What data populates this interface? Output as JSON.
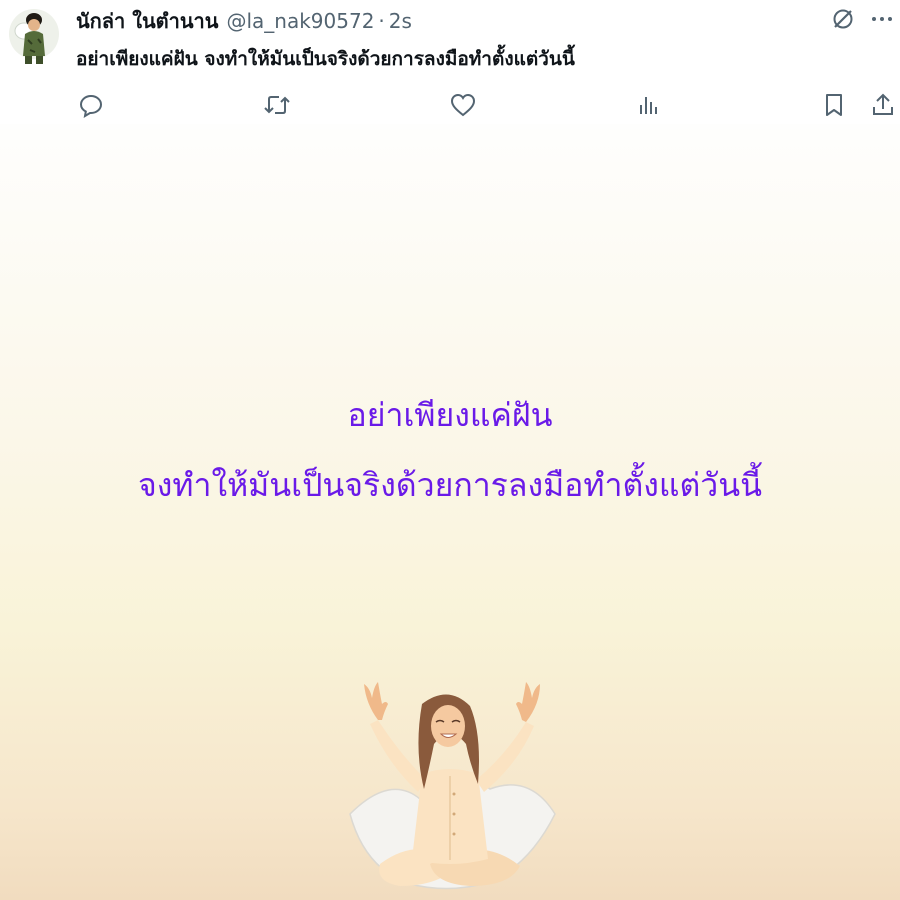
{
  "author": {
    "display_name": "นักล่า ในตำนาน",
    "handle": "@la_nak90572",
    "separator": "·",
    "time": "2s"
  },
  "tweet": {
    "text": "อย่าเพียงแค่ฝัน จงทำให้มันเป็นจริงด้วยการลงมือทำตั้งแต่วันนี้"
  },
  "media": {
    "line1": "อย่าเพียงแค่ฝัน",
    "line2": "จงทำให้มันเป็นจริงด้วยการลงมือทำตั้งแต่วันนี้",
    "text_color": "#6a1ae8"
  },
  "icons": {
    "top": [
      "grok-icon",
      "more-icon"
    ],
    "actions": [
      "reply-icon",
      "retweet-icon",
      "like-icon",
      "views-icon",
      "bookmark-icon",
      "share-icon"
    ]
  }
}
